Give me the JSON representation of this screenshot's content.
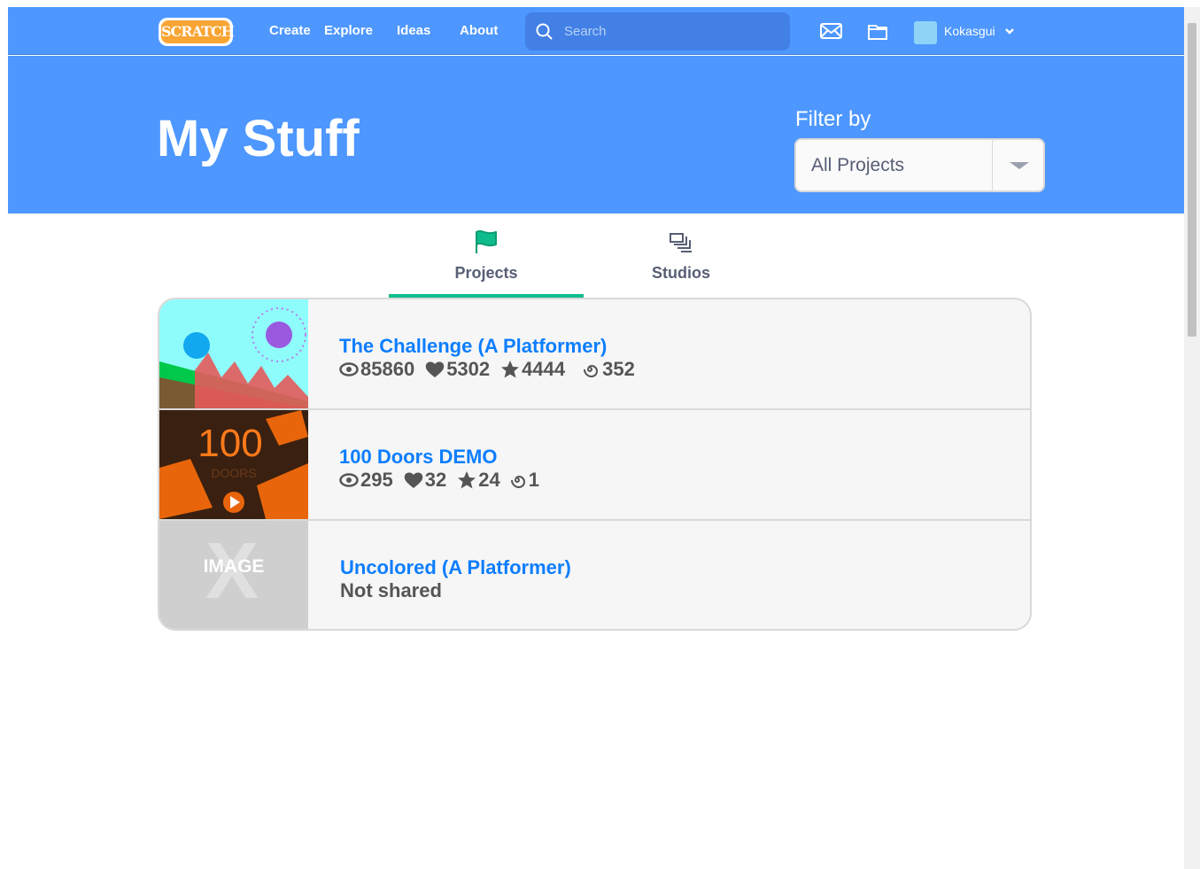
{
  "nav": {
    "logo": "SCRATCH",
    "links": [
      "Create",
      "Explore",
      "Ideas",
      "About"
    ],
    "search_placeholder": "Search",
    "username": "Kokasgui"
  },
  "header": {
    "title": "My Stuff",
    "filter_label": "Filter by",
    "filter_value": "All Projects"
  },
  "tabs": [
    {
      "label": "Projects",
      "active": true,
      "icon": "flag-icon"
    },
    {
      "label": "Studios",
      "active": false,
      "icon": "studios-icon"
    }
  ],
  "projects": [
    {
      "title": "The Challenge (A Platformer)",
      "views": "85860",
      "loves": "5302",
      "favorites": "4444",
      "remixes": "352"
    },
    {
      "title": "100 Doors DEMO",
      "views": "295",
      "loves": "32",
      "favorites": "24",
      "remixes": "1"
    },
    {
      "title": "Uncolored (A Platformer)",
      "status": "Not shared",
      "thumb_text": "IMAGE"
    }
  ],
  "colors": {
    "brand": "#4d97ff",
    "link": "#0d7eff",
    "tab_accent": "#0fbd8c"
  }
}
